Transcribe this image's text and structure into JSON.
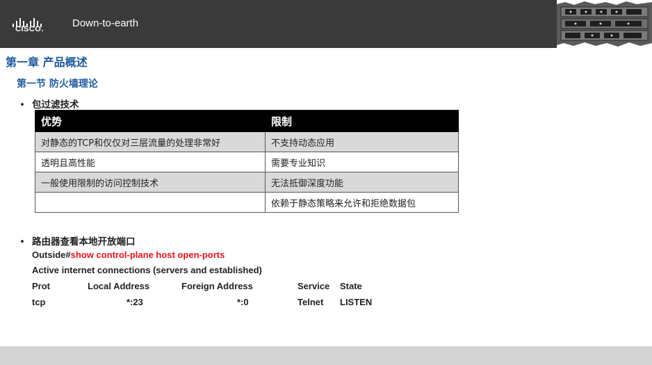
{
  "header": {
    "logo_text": "CISCO.",
    "tagline": "Down-to-earth"
  },
  "chapter_title": "第一章  产品概述",
  "section_title": "第一节  防火墙理论",
  "bullet_glyph": "•",
  "bullet1": "包过滤技术",
  "table": {
    "headers": [
      "优势",
      "限制"
    ],
    "rows": [
      [
        "对静态的TCP和仅仅对三层流量的处理非常好",
        "不支持动态应用"
      ],
      [
        "透明且高性能",
        "需要专业知识"
      ],
      [
        "一般使用限制的访问控制技术",
        "无法抵御深度功能"
      ],
      [
        "",
        "依赖于静态策略来允许和拒绝数据包"
      ]
    ]
  },
  "bullet2": "路由器查看本地开放端口",
  "cli": {
    "prompt": "Outside#",
    "command": "show  control-plane  host open-ports",
    "line1": "Active internet connections (servers and established)",
    "columns": [
      "Prot",
      "Local Address",
      "Foreign Address",
      "Service",
      "State"
    ],
    "row": [
      "tcp",
      "*:23",
      "*:0",
      "Telnet",
      "LISTEN"
    ]
  },
  "colors": {
    "header_bg": "#3a3a3a",
    "heading_blue": "#1f5a9e",
    "command_red": "#e8121b",
    "table_header_bg": "#000000",
    "row_shade": "#d9d9d9"
  },
  "icons": {
    "logo": "cisco-bridge-logo",
    "header_image": "network-hardware-photo"
  }
}
